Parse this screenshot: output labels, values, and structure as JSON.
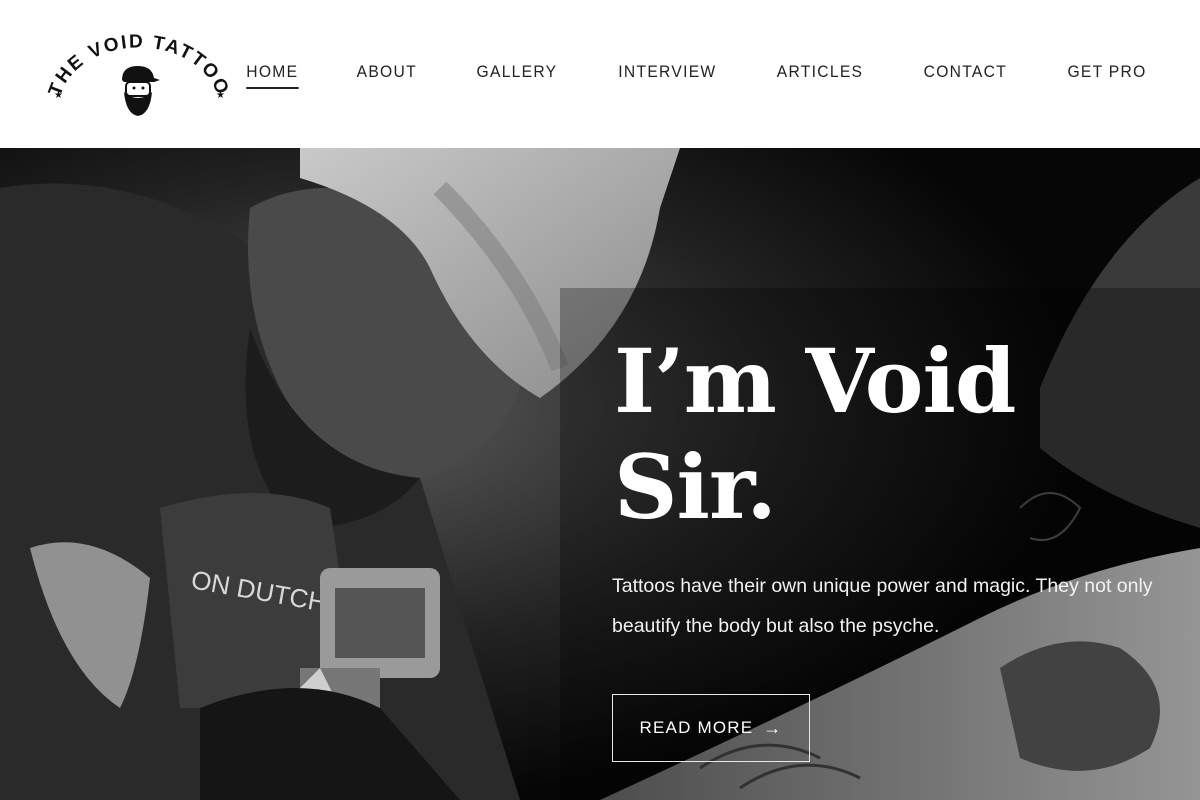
{
  "brand": {
    "logo_text": "THE VOID TATTOO"
  },
  "nav": {
    "items": [
      {
        "label": "HOME",
        "active": true
      },
      {
        "label": "ABOUT",
        "active": false
      },
      {
        "label": "GALLERY",
        "active": false
      },
      {
        "label": "INTERVIEW",
        "active": false
      },
      {
        "label": "ARTICLES",
        "active": false
      },
      {
        "label": "CONTACT",
        "active": false
      },
      {
        "label": "GET PRO",
        "active": false
      }
    ]
  },
  "hero": {
    "title_line1": "I’m Void",
    "title_line2": "Sir.",
    "description": "Tattoos have their own unique power and magic. They not only beautify the body but also the psyche.",
    "button_label": "READ MORE",
    "button_icon": "arrow-right-icon"
  },
  "colors": {
    "header_bg": "#ffffff",
    "nav_text": "#222222",
    "hero_bg": "#0b0b0b",
    "hero_text": "#ffffff"
  }
}
